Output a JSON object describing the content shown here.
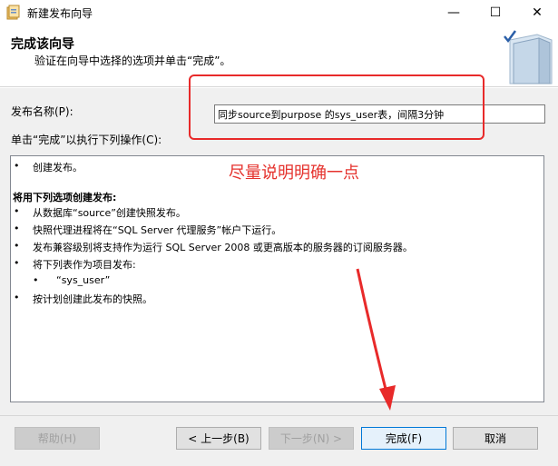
{
  "window": {
    "title": "新建发布向导",
    "min_glyph": "—",
    "max_glyph": "☐",
    "close_glyph": "✕"
  },
  "header": {
    "title": "完成该向导",
    "subtitle": "验证在向导中选择的选项并单击“完成”。"
  },
  "form": {
    "name_label": "发布名称(P):",
    "name_value": "同步source到purpose 的sys_user表，间隔3分钟",
    "ops_label": "单击“完成”以执行下列操作(C):"
  },
  "operations": {
    "bullet": "•",
    "line1": "创建发布。",
    "heading": "将用下列选项创建发布:",
    "opt1": "从数据库“source”创建快照发布。",
    "opt2": "快照代理进程将在“SQL Server 代理服务”帐户下运行。",
    "opt3": "发布兼容级别将支持作为运行 SQL Server 2008 或更高版本的服务器的订阅服务器。",
    "opt4": "将下列表作为项目发布:",
    "sub1": "“sys_user”",
    "opt5": "按计划创建此发布的快照。"
  },
  "annotation": {
    "text": "尽量说明明确一点",
    "color": "#e5322d"
  },
  "buttons": {
    "help": "帮助(H)",
    "prev": "< 上一步(B)",
    "next": "下一步(N) >",
    "finish": "完成(F)",
    "cancel": "取消"
  },
  "icons": {
    "app": "wizard-app-icon",
    "header_art": "book-check-icon"
  }
}
